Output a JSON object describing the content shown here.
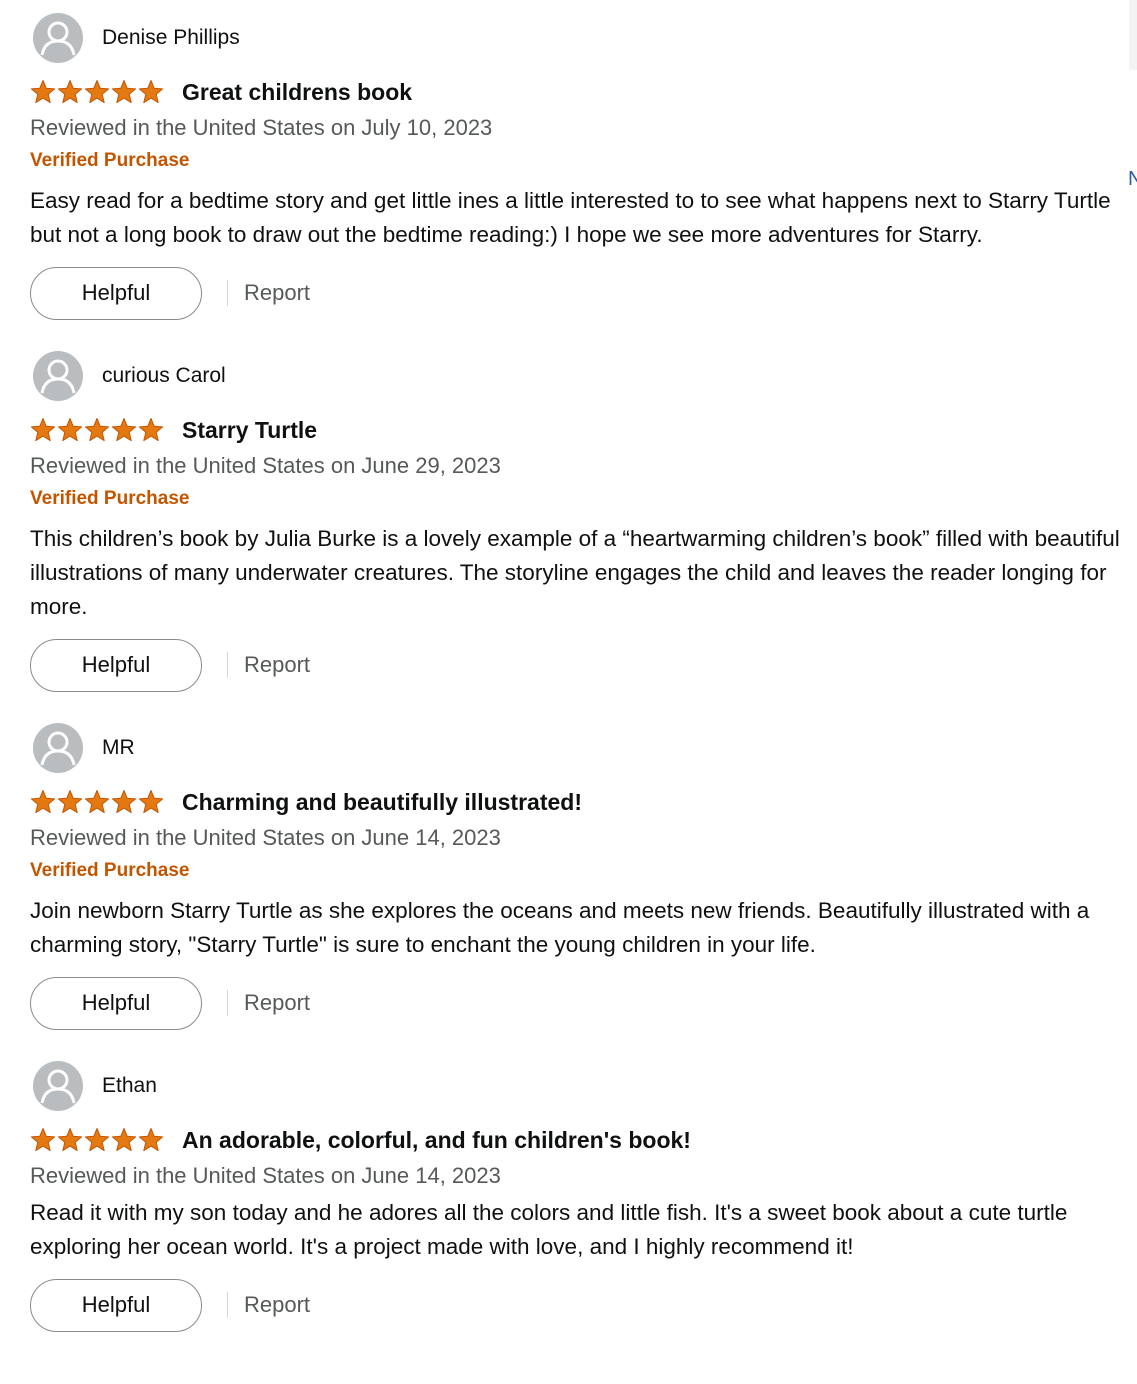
{
  "colors": {
    "star": "#e47911",
    "verified": "#c45500",
    "muted": "#565959",
    "text": "#0f1111",
    "avatar_bg": "#b9bdbf"
  },
  "edge_glyph": "N",
  "reviews": [
    {
      "name": "Denise Phillips",
      "rating": 5,
      "title": "Great childrens book",
      "date": "Reviewed in the United States on July 10, 2023",
      "verified": "Verified Purchase",
      "body": "Easy read for a bedtime story and get little ines a little interested to to see what happens next to Starry Turtle but not a long book to draw out the bedtime reading:) I hope we see more adventures for Starry.",
      "helpful_label": "Helpful",
      "report_label": "Report"
    },
    {
      "name": "curious Carol",
      "rating": 5,
      "title": "Starry Turtle",
      "date": "Reviewed in the United States on June 29, 2023",
      "verified": "Verified Purchase",
      "body": "This children’s book by Julia Burke is a lovely example of a “heartwarming children’s book” filled with beautiful illustrations of many underwater creatures. The storyline engages the child and leaves the reader longing for more.",
      "helpful_label": "Helpful",
      "report_label": "Report"
    },
    {
      "name": "MR",
      "rating": 5,
      "title": "Charming and beautifully illustrated!",
      "date": "Reviewed in the United States on June 14, 2023",
      "verified": "Verified Purchase",
      "body": "Join newborn Starry Turtle as she explores the oceans and meets new friends. Beautifully illustrated with a charming story, \"Starry Turtle\" is sure to enchant the young children in your life.",
      "helpful_label": "Helpful",
      "report_label": "Report"
    },
    {
      "name": "Ethan",
      "rating": 5,
      "title": "An adorable, colorful, and fun children's book!",
      "date": "Reviewed in the United States on June 14, 2023",
      "verified": "",
      "body": "Read it with my son today and he adores all the colors and little fish. It's a sweet book about a cute turtle exploring her ocean world. It's a project made with love, and I highly recommend it!",
      "helpful_label": "Helpful",
      "report_label": "Report"
    }
  ]
}
